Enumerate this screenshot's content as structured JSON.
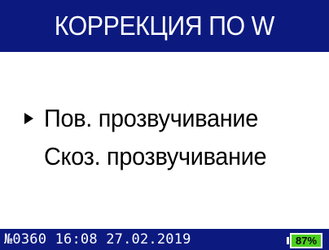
{
  "header": {
    "title": "КОРРЕКЦИЯ ПО W"
  },
  "menu": {
    "items": [
      {
        "label": "Пов. прозвучивание",
        "selected": true
      },
      {
        "label": "Скоз. прозвучивание",
        "selected": false
      }
    ]
  },
  "statusbar": {
    "info": "№0360 16:08 27.02.2019",
    "battery_label": "87%",
    "battery_level": 0.87
  },
  "colors": {
    "header_bg": "#0c1a80",
    "status_bg": "#0c1a80",
    "battery_fill": "#4bcf1f",
    "text_light": "#ffffff",
    "text_dark": "#000000"
  },
  "icons": {
    "cursor": "triangle-right-icon",
    "battery": "battery-icon"
  }
}
